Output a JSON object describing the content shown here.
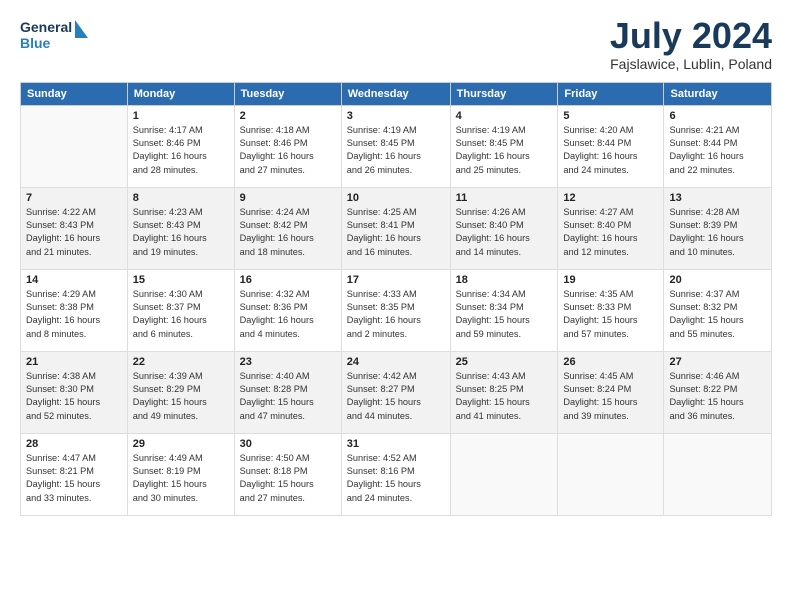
{
  "header": {
    "logo_line1": "General",
    "logo_line2": "Blue",
    "month": "July 2024",
    "location": "Fajslawice, Lublin, Poland"
  },
  "weekdays": [
    "Sunday",
    "Monday",
    "Tuesday",
    "Wednesday",
    "Thursday",
    "Friday",
    "Saturday"
  ],
  "weeks": [
    [
      {
        "day": "",
        "info": ""
      },
      {
        "day": "1",
        "info": "Sunrise: 4:17 AM\nSunset: 8:46 PM\nDaylight: 16 hours\nand 28 minutes."
      },
      {
        "day": "2",
        "info": "Sunrise: 4:18 AM\nSunset: 8:46 PM\nDaylight: 16 hours\nand 27 minutes."
      },
      {
        "day": "3",
        "info": "Sunrise: 4:19 AM\nSunset: 8:45 PM\nDaylight: 16 hours\nand 26 minutes."
      },
      {
        "day": "4",
        "info": "Sunrise: 4:19 AM\nSunset: 8:45 PM\nDaylight: 16 hours\nand 25 minutes."
      },
      {
        "day": "5",
        "info": "Sunrise: 4:20 AM\nSunset: 8:44 PM\nDaylight: 16 hours\nand 24 minutes."
      },
      {
        "day": "6",
        "info": "Sunrise: 4:21 AM\nSunset: 8:44 PM\nDaylight: 16 hours\nand 22 minutes."
      }
    ],
    [
      {
        "day": "7",
        "info": "Sunrise: 4:22 AM\nSunset: 8:43 PM\nDaylight: 16 hours\nand 21 minutes."
      },
      {
        "day": "8",
        "info": "Sunrise: 4:23 AM\nSunset: 8:43 PM\nDaylight: 16 hours\nand 19 minutes."
      },
      {
        "day": "9",
        "info": "Sunrise: 4:24 AM\nSunset: 8:42 PM\nDaylight: 16 hours\nand 18 minutes."
      },
      {
        "day": "10",
        "info": "Sunrise: 4:25 AM\nSunset: 8:41 PM\nDaylight: 16 hours\nand 16 minutes."
      },
      {
        "day": "11",
        "info": "Sunrise: 4:26 AM\nSunset: 8:40 PM\nDaylight: 16 hours\nand 14 minutes."
      },
      {
        "day": "12",
        "info": "Sunrise: 4:27 AM\nSunset: 8:40 PM\nDaylight: 16 hours\nand 12 minutes."
      },
      {
        "day": "13",
        "info": "Sunrise: 4:28 AM\nSunset: 8:39 PM\nDaylight: 16 hours\nand 10 minutes."
      }
    ],
    [
      {
        "day": "14",
        "info": "Sunrise: 4:29 AM\nSunset: 8:38 PM\nDaylight: 16 hours\nand 8 minutes."
      },
      {
        "day": "15",
        "info": "Sunrise: 4:30 AM\nSunset: 8:37 PM\nDaylight: 16 hours\nand 6 minutes."
      },
      {
        "day": "16",
        "info": "Sunrise: 4:32 AM\nSunset: 8:36 PM\nDaylight: 16 hours\nand 4 minutes."
      },
      {
        "day": "17",
        "info": "Sunrise: 4:33 AM\nSunset: 8:35 PM\nDaylight: 16 hours\nand 2 minutes."
      },
      {
        "day": "18",
        "info": "Sunrise: 4:34 AM\nSunset: 8:34 PM\nDaylight: 15 hours\nand 59 minutes."
      },
      {
        "day": "19",
        "info": "Sunrise: 4:35 AM\nSunset: 8:33 PM\nDaylight: 15 hours\nand 57 minutes."
      },
      {
        "day": "20",
        "info": "Sunrise: 4:37 AM\nSunset: 8:32 PM\nDaylight: 15 hours\nand 55 minutes."
      }
    ],
    [
      {
        "day": "21",
        "info": "Sunrise: 4:38 AM\nSunset: 8:30 PM\nDaylight: 15 hours\nand 52 minutes."
      },
      {
        "day": "22",
        "info": "Sunrise: 4:39 AM\nSunset: 8:29 PM\nDaylight: 15 hours\nand 49 minutes."
      },
      {
        "day": "23",
        "info": "Sunrise: 4:40 AM\nSunset: 8:28 PM\nDaylight: 15 hours\nand 47 minutes."
      },
      {
        "day": "24",
        "info": "Sunrise: 4:42 AM\nSunset: 8:27 PM\nDaylight: 15 hours\nand 44 minutes."
      },
      {
        "day": "25",
        "info": "Sunrise: 4:43 AM\nSunset: 8:25 PM\nDaylight: 15 hours\nand 41 minutes."
      },
      {
        "day": "26",
        "info": "Sunrise: 4:45 AM\nSunset: 8:24 PM\nDaylight: 15 hours\nand 39 minutes."
      },
      {
        "day": "27",
        "info": "Sunrise: 4:46 AM\nSunset: 8:22 PM\nDaylight: 15 hours\nand 36 minutes."
      }
    ],
    [
      {
        "day": "28",
        "info": "Sunrise: 4:47 AM\nSunset: 8:21 PM\nDaylight: 15 hours\nand 33 minutes."
      },
      {
        "day": "29",
        "info": "Sunrise: 4:49 AM\nSunset: 8:19 PM\nDaylight: 15 hours\nand 30 minutes."
      },
      {
        "day": "30",
        "info": "Sunrise: 4:50 AM\nSunset: 8:18 PM\nDaylight: 15 hours\nand 27 minutes."
      },
      {
        "day": "31",
        "info": "Sunrise: 4:52 AM\nSunset: 8:16 PM\nDaylight: 15 hours\nand 24 minutes."
      },
      {
        "day": "",
        "info": ""
      },
      {
        "day": "",
        "info": ""
      },
      {
        "day": "",
        "info": ""
      }
    ]
  ]
}
